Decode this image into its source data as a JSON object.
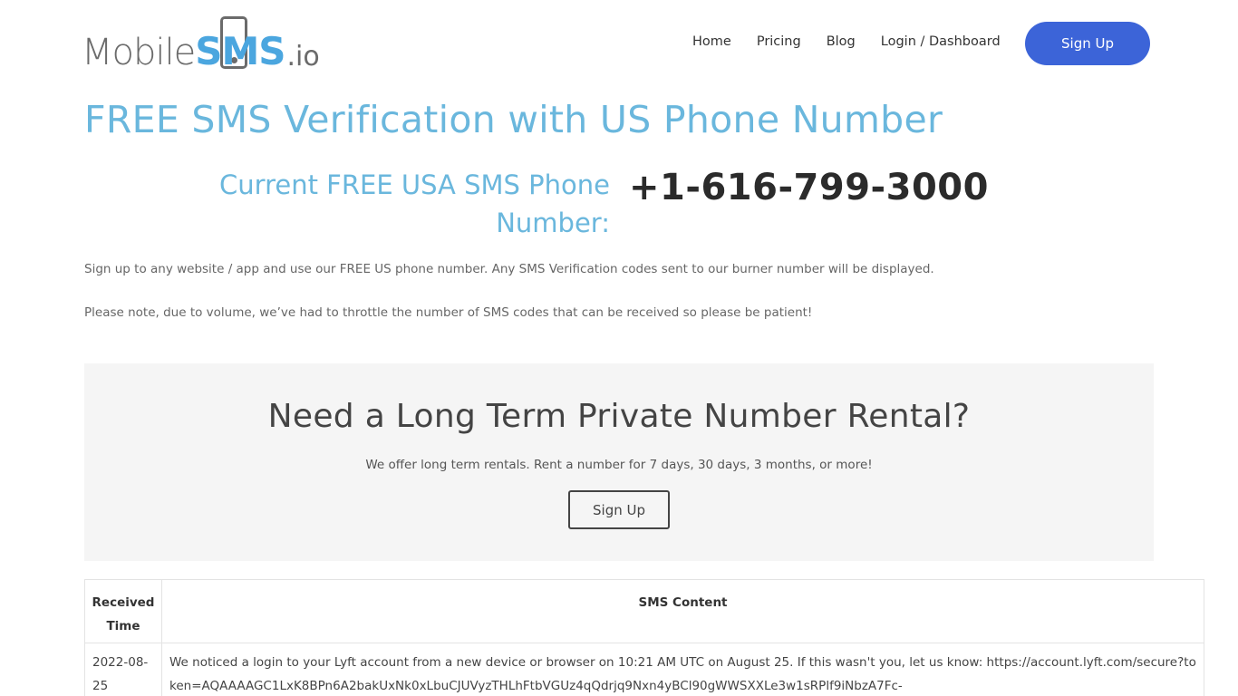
{
  "logo": {
    "part1": "Mobile",
    "part2": "SMS",
    "part3": ".io"
  },
  "nav": {
    "items": [
      {
        "label": "Home"
      },
      {
        "label": "Pricing"
      },
      {
        "label": "Blog"
      },
      {
        "label": "Login / Dashboard"
      }
    ],
    "signup_label": "Sign Up"
  },
  "main": {
    "title": "FREE SMS Verification with US Phone Number",
    "current_label": "Current FREE USA SMS Phone Number:",
    "phone_number": "+1-616-799-3000",
    "paragraph1": "Sign up to any website / app and use our FREE US phone number. Any SMS Verification codes sent to our burner number will be displayed.",
    "paragraph2": "Please note, due to volume, we’ve had to throttle the number of SMS codes that can be received so please be patient!"
  },
  "promo": {
    "title": "Need a Long Term Private Number Rental?",
    "subtitle": "We offer long term rentals. Rent a number for 7 days, 30 days, 3 months, or more!",
    "button_label": "Sign Up"
  },
  "table": {
    "headers": [
      "Received Time",
      "SMS Content"
    ],
    "rows": [
      {
        "time": "2022-08-25",
        "content": "We noticed a login to your Lyft account from a new device or browser on 10:21 AM UTC on August 25. If this wasn't you, let us know: https://account.lyft.com/secure?token=AQAAAAGC1LxK8BPn6A2bakUxNk0xLbuCJUVyzTHLhFtbVGUz4qQdrjq9Nxn4yBCl90gWWSXXLe3w1sRPlf9iNbzA7Fc-"
      }
    ]
  },
  "colors": {
    "accent_blue": "#6ab7dd",
    "button_blue": "#3c64d8",
    "promo_bg": "#f5f5f5"
  }
}
